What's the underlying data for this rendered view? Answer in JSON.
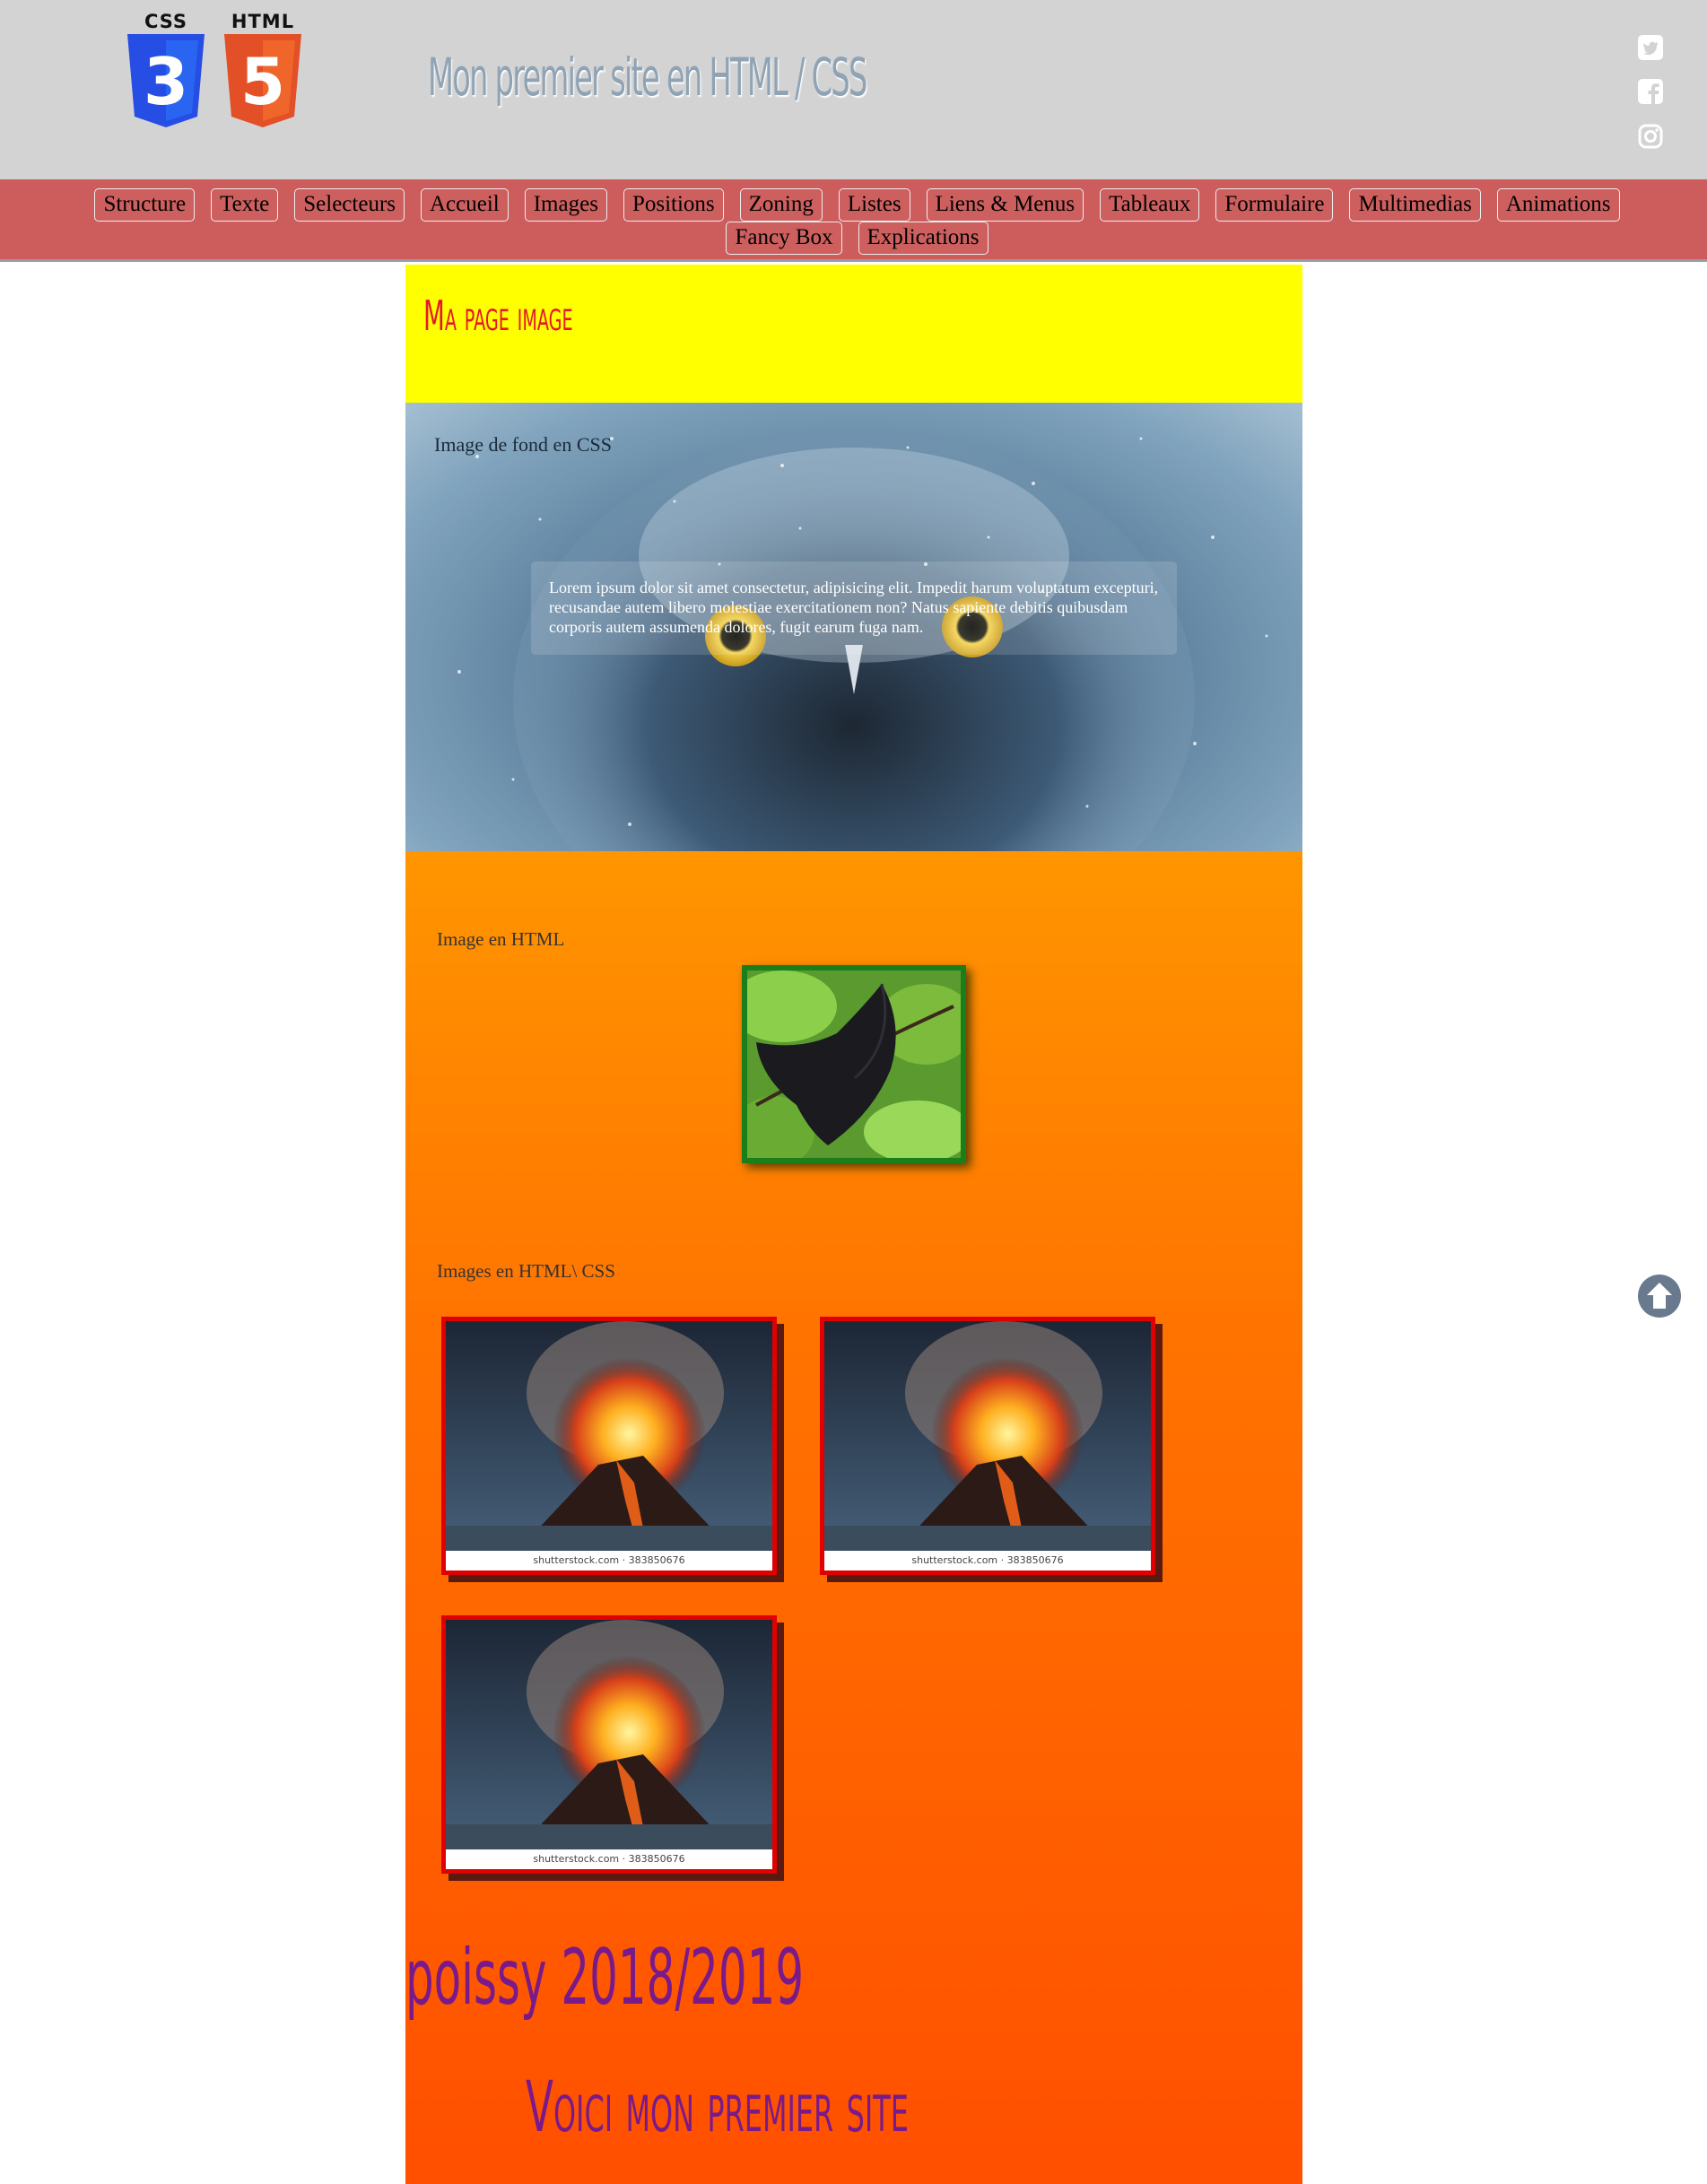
{
  "header": {
    "logo_css_label": "CSS",
    "logo_html_label": "HTML",
    "logo_css_number": "3",
    "logo_html_number": "5",
    "title": "Mon premier site en HTML / CSS",
    "social_icons": [
      "twitter-icon",
      "facebook-icon",
      "instagram-icon"
    ]
  },
  "nav": {
    "items": [
      "Structure",
      "Texte",
      "Selecteurs",
      "Accueil",
      "Images",
      "Positions",
      "Zoning",
      "Listes",
      "Liens & Menus",
      "Tableaux",
      "Formulaire",
      "Multimedias",
      "Animations",
      "Fancy Box",
      "Explications"
    ]
  },
  "main": {
    "page_title": "Ma page image",
    "bg_image_label": "Image de fond en CSS",
    "lorem": "Lorem ipsum dolor sit amet consectetur, adipisicing elit. Impedit harum voluptatum excepturi, recusandae autem libero molestiae exercitationem non? Natus sapiente debitis quibusdam corporis autem assumenda dolores, fugit earum fuga nam.",
    "html_image_label": "Image en HTML",
    "html_css_images_label": "Images en HTML\\ CSS",
    "image_caption": "shutterstock.com · 383850676"
  },
  "footer": {
    "year": "poissy 2018/2019",
    "tagline": "Voici mon premier site"
  },
  "colors": {
    "header_bg": "#d3d3d3",
    "nav_bg": "#cd5c5c",
    "title_yellow_bg": "#ffff00",
    "page_title_red": "#e3192b",
    "footer_purple": "#7a1a8a",
    "frame_red": "#e00000",
    "frame_green": "#1a7f1a"
  },
  "icons": {
    "scroll_top": "arrow-up-circle-icon"
  }
}
